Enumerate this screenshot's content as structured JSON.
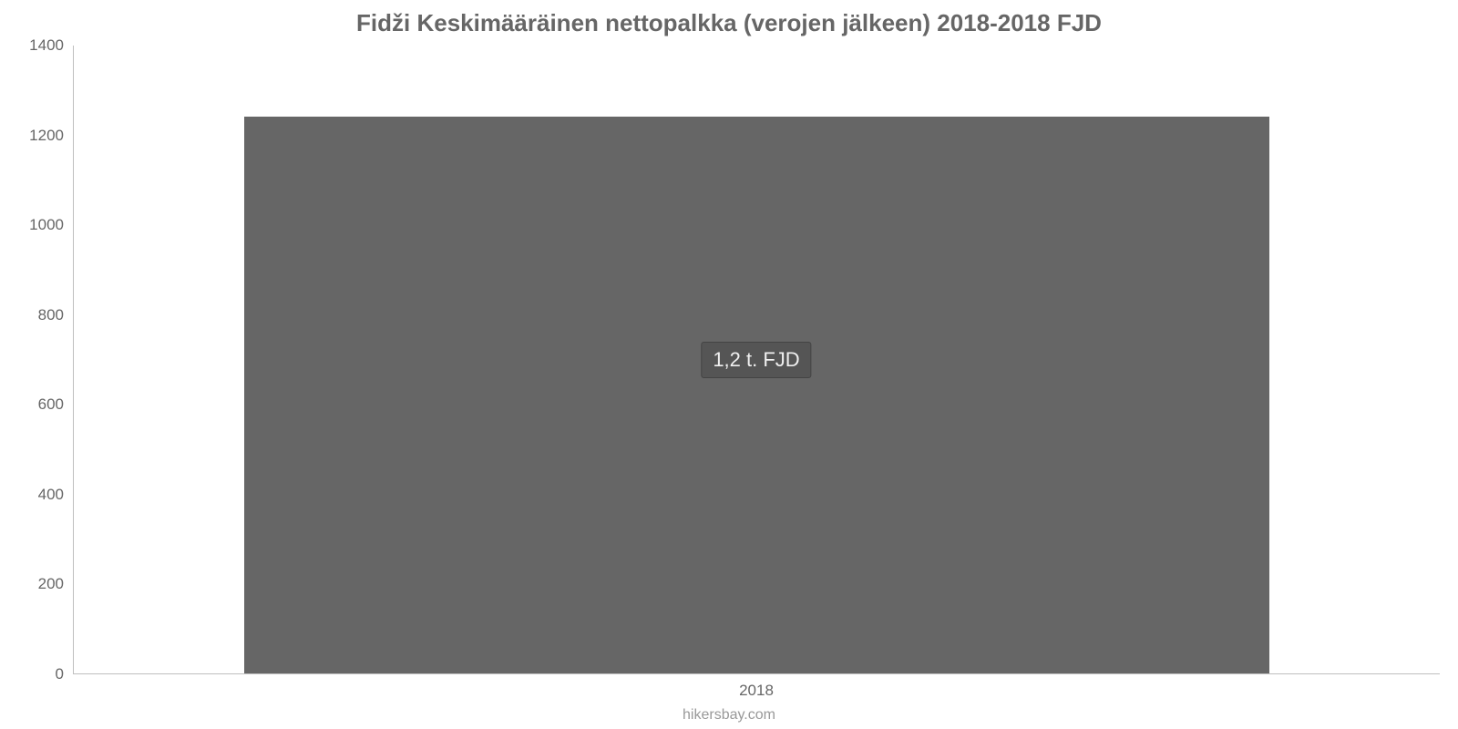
{
  "chart_data": {
    "type": "bar",
    "title": "Fidži Keskimääräinen nettopalkka (verojen jälkeen) 2018-2018 FJD",
    "categories": [
      "2018"
    ],
    "values": [
      1240
    ],
    "data_labels": [
      "1,2 t. FJD"
    ],
    "xlabel": "",
    "ylabel": "",
    "ylim": [
      0,
      1400
    ],
    "y_ticks": [
      0,
      200,
      400,
      600,
      800,
      1000,
      1200,
      1400
    ],
    "bar_color": "#666666",
    "credit": "hikersbay.com"
  }
}
